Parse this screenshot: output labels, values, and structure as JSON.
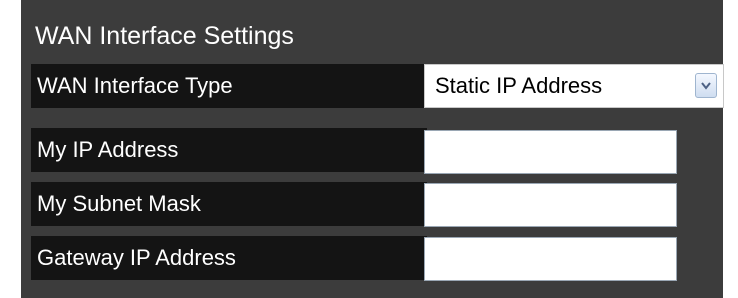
{
  "section": {
    "title": "WAN Interface Settings"
  },
  "wan_type": {
    "label": "WAN Interface Type",
    "selected": "Static IP Address"
  },
  "fields": [
    {
      "label": "My IP Address",
      "value": ""
    },
    {
      "label": "My Subnet Mask",
      "value": ""
    },
    {
      "label": "Gateway IP Address",
      "value": ""
    }
  ],
  "colors": {
    "panel_bg": "#3c3c3c",
    "label_bg": "#141414",
    "text": "#ffffff",
    "accent": "#9fb5cf"
  },
  "icons": {
    "select_arrow": "chevron-down-icon"
  }
}
